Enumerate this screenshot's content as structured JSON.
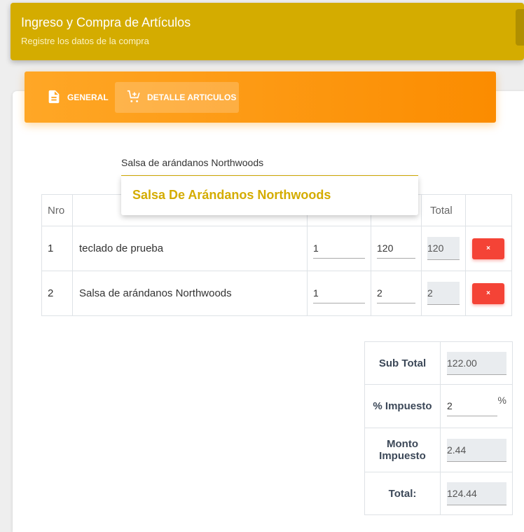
{
  "header": {
    "title": "Ingreso y Compra de Artículos",
    "subtitle": "Registre los datos de la compra"
  },
  "tabs": [
    {
      "label": "GENERAL",
      "icon": "document-icon"
    },
    {
      "label": "DETALLE ARTICULOS",
      "icon": "cart-plus-icon",
      "active": true
    }
  ],
  "search": {
    "value": "Salsa de arándanos Northwoods",
    "suggestion": "Salsa De Arándanos Northwoods"
  },
  "table": {
    "headers": {
      "nro": "Nro",
      "description": "",
      "quantity": "",
      "price": "",
      "total": "Total",
      "actions": ""
    },
    "rows": [
      {
        "nro": "1",
        "description": "teclado de prueba",
        "quantity": "1",
        "price": "120",
        "total": "120",
        "delete_label": "×"
      },
      {
        "nro": "2",
        "description": "Salsa de arándanos Northwoods",
        "quantity": "1",
        "price": "2",
        "total": "2",
        "delete_label": "×"
      }
    ]
  },
  "summary": {
    "subtotal_label": "Sub Total",
    "subtotal_value": "122.00",
    "tax_label": "% Impuesto",
    "tax_value": "2",
    "tax_suffix": "%",
    "tax_amount_label": "Monto Impuesto",
    "tax_amount_value": "2.44",
    "total_label": "Total:",
    "total_value": "124.44"
  },
  "colors": {
    "header_bg": "#d4ac00",
    "tabs_gradient_start": "#ffa726",
    "tabs_gradient_end": "#fb8c00",
    "delete_button": "#f44336"
  }
}
